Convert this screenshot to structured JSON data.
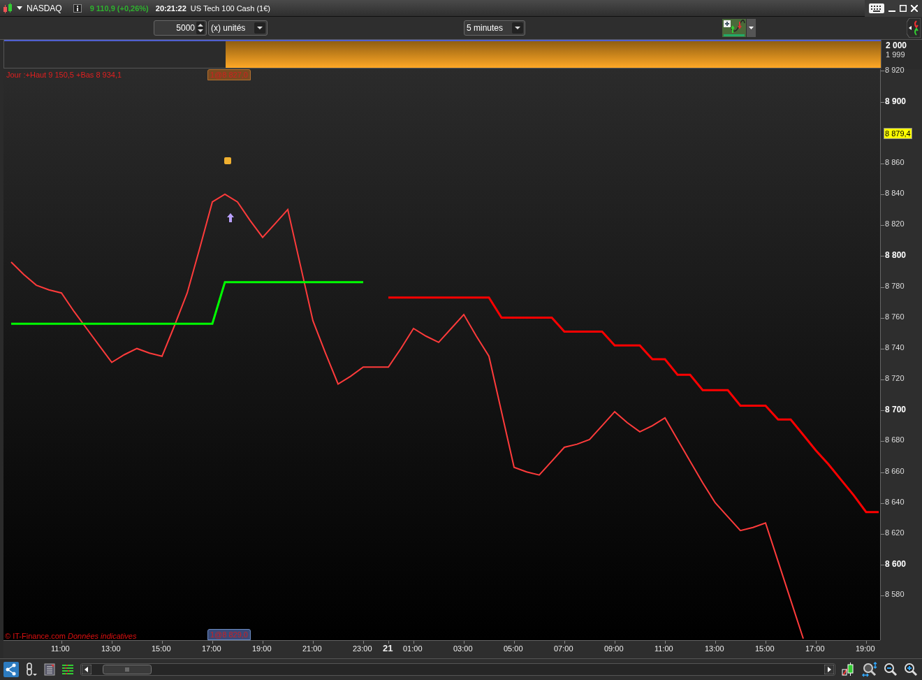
{
  "window": {
    "instrument": "NASDAQ",
    "price": "9 110,9 (+0,26%)",
    "time": "20:21:22",
    "title": "US Tech 100 Cash (1€)"
  },
  "toolbar": {
    "quantity": "5000",
    "unit": "(x) unités",
    "timeframe": "5 minutes"
  },
  "indicator_panel": {
    "labels": [
      "2 000",
      "1 999"
    ]
  },
  "chart": {
    "header": "Jour :+Haut 9 150,5 +Bas 8 934,1",
    "top_order": "1@8 827,0",
    "bottom_order": "1@8 829,0",
    "footer_source": "© IT-Finance.com",
    "footer_note": "Données indicatives",
    "last_price": "8 879,4",
    "chart_data": {
      "type": "line",
      "ylim": [
        8551,
        8921
      ],
      "categories": [
        null,
        null,
        null,
        null,
        "11:00",
        null,
        null,
        null,
        "13:00",
        null,
        null,
        null,
        "15:00",
        null,
        null,
        null,
        "17:00",
        null,
        null,
        null,
        "19:00",
        null,
        null,
        null,
        "21:00",
        null,
        null,
        null,
        "23:00",
        null,
        "21",
        null,
        "01:00",
        null,
        null,
        null,
        "03:00",
        null,
        null,
        null,
        "05:00",
        null,
        null,
        null,
        "07:00",
        null,
        null,
        null,
        "09:00",
        null,
        null,
        null,
        "11:00",
        null,
        null,
        null,
        "13:00",
        null,
        null,
        null,
        "15:00",
        null,
        null,
        null,
        "17:00",
        null,
        null,
        null,
        "19:00",
        null
      ],
      "yticks": [
        {
          "value": 8920,
          "label": "8 920"
        },
        {
          "value": 8900,
          "label": "8 900"
        },
        {
          "value": 8860,
          "label": "8 860"
        },
        {
          "value": 8840,
          "label": "8 840"
        },
        {
          "value": 8820,
          "label": "8 820"
        },
        {
          "value": 8800,
          "label": "8 800"
        },
        {
          "value": 8780,
          "label": "8 780"
        },
        {
          "value": 8760,
          "label": "8 760"
        },
        {
          "value": 8740,
          "label": "8 740"
        },
        {
          "value": 8720,
          "label": "8 720"
        },
        {
          "value": 8700,
          "label": "8 700"
        },
        {
          "value": 8680,
          "label": "8 680"
        },
        {
          "value": 8660,
          "label": "8 660"
        },
        {
          "value": 8640,
          "label": "8 640"
        },
        {
          "value": 8620,
          "label": "8 620"
        },
        {
          "value": 8600,
          "label": "8 600"
        },
        {
          "value": 8580,
          "label": "8 580"
        }
      ],
      "series": [
        {
          "color": "#ff3b3b",
          "values": [
            8796,
            8788,
            8781,
            8778,
            8776,
            8764,
            8753,
            8742,
            8731,
            8736,
            8740,
            8737,
            8735,
            8755,
            8776,
            8805,
            8835,
            8840,
            8835,
            8823,
            8812,
            8821,
            8830,
            8794,
            8758,
            8737,
            8717,
            8722,
            8728,
            8728,
            8728,
            8740,
            8753,
            8748,
            8744,
            8753,
            8762,
            8748,
            8735,
            8699,
            8663,
            8660,
            8658,
            8667,
            8676,
            8678,
            8681,
            8690,
            8699,
            8692,
            8686,
            8690,
            8695,
            8681,
            8667,
            8653,
            8640,
            8631,
            8622,
            8624,
            8627,
            8602,
            8577,
            8552,
            null,
            null,
            null,
            null,
            null,
            null
          ]
        },
        {
          "color": "#00ff00",
          "values": [
            8756,
            8756,
            8756,
            8756,
            8756,
            8756,
            8756,
            8756,
            8756,
            8756,
            8756,
            8756,
            8756,
            8756,
            8756,
            8756,
            8756,
            8783,
            8783,
            8783,
            8783,
            8783,
            8783,
            8783,
            8783,
            8783,
            8783,
            8783,
            8783,
            null,
            null,
            null,
            null,
            null,
            null,
            null,
            null,
            null,
            null,
            null,
            null,
            null,
            null,
            null,
            null,
            null,
            null,
            null,
            null,
            null,
            null,
            null,
            null,
            null,
            null,
            null,
            null,
            null,
            null,
            null,
            null,
            null,
            null,
            null,
            null,
            null,
            null,
            null,
            null,
            null
          ]
        },
        {
          "color": "#ff0000",
          "values": [
            null,
            null,
            null,
            null,
            null,
            null,
            null,
            null,
            null,
            null,
            null,
            null,
            null,
            null,
            null,
            null,
            null,
            null,
            null,
            null,
            null,
            null,
            null,
            null,
            null,
            null,
            null,
            null,
            null,
            null,
            8773,
            8773,
            8773,
            8773,
            8773,
            8773,
            8773,
            8773,
            8773,
            8760,
            8760,
            8760,
            8760,
            8760,
            8751,
            8751,
            8751,
            8751,
            8742,
            8742,
            8742,
            8733,
            8733,
            8723,
            8723,
            8713,
            8713,
            8713,
            8703,
            8703,
            8703,
            8694,
            8694,
            8684,
            8674,
            8665,
            8655,
            8645,
            8634,
            8634
          ]
        }
      ]
    }
  }
}
